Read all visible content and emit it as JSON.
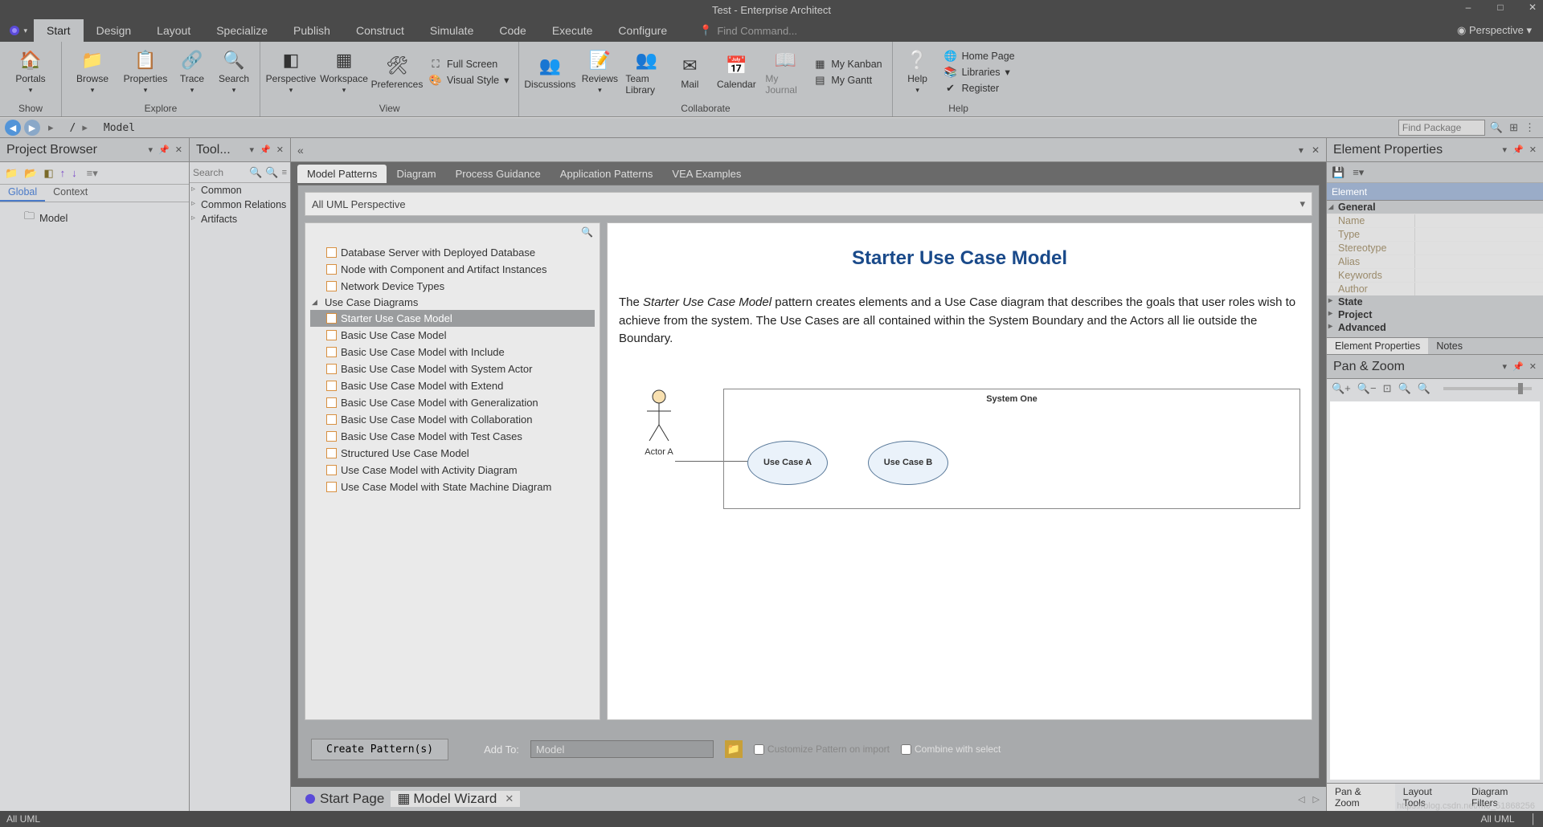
{
  "window": {
    "title": "Test - Enterprise Architect"
  },
  "ribbon": {
    "tabs": [
      "Start",
      "Design",
      "Layout",
      "Specialize",
      "Publish",
      "Construct",
      "Simulate",
      "Code",
      "Execute",
      "Configure"
    ],
    "active": "Start",
    "find_command_ph": "Find Command...",
    "perspective": "Perspective",
    "groups": {
      "show": {
        "label": "Show",
        "portals": "Portals"
      },
      "explore": {
        "label": "Explore",
        "browse": "Browse",
        "properties": "Properties",
        "trace": "Trace",
        "search": "Search"
      },
      "view": {
        "label": "View",
        "perspective": "Perspective",
        "workspace": "Workspace",
        "preferences": "Preferences",
        "fullscreen": "Full Screen",
        "visualstyle": "Visual Style"
      },
      "collaborate": {
        "label": "Collaborate",
        "discussions": "Discussions",
        "reviews": "Reviews",
        "team": "Team Library",
        "mail": "Mail",
        "calendar": "Calendar",
        "journal": "My Journal",
        "kanban": "My Kanban",
        "gantt": "My Gantt"
      },
      "help": {
        "label": "Help",
        "help": "Help",
        "home": "Home Page",
        "libraries": "Libraries",
        "register": "Register"
      }
    }
  },
  "nav": {
    "crumb1": "/",
    "crumb2": "Model",
    "find_package_ph": "Find Package"
  },
  "project_browser": {
    "title": "Project Browser",
    "tabs": [
      "Global",
      "Context"
    ],
    "active": "Global",
    "root": "Model"
  },
  "toolbox": {
    "title": "Tool...",
    "search_ph": "Search",
    "items": [
      "Common",
      "Common Relations",
      "Artifacts"
    ]
  },
  "wizard": {
    "tabs": [
      "Model Patterns",
      "Diagram",
      "Process Guidance",
      "Application Patterns",
      "VEA Examples"
    ],
    "active": "Model Patterns",
    "perspective": "All UML Perspective",
    "deployment_items": [
      "Database Server with Deployed Database",
      "Node with Component and Artifact Instances",
      "Network Device Types"
    ],
    "usecase_cat": "Use Case Diagrams",
    "usecase_items": [
      "Starter Use Case Model",
      "Basic Use Case Model",
      "Basic Use Case Model with Include",
      "Basic Use Case Model with System Actor",
      "Basic Use Case Model with Extend",
      "Basic Use Case Model with Generalization",
      "Basic Use Case Model with Collaboration",
      "Basic Use Case Model with Test Cases",
      "Structured Use Case Model",
      "Use Case Model with Activity Diagram",
      "Use Case Model with State Machine Diagram"
    ],
    "selected": "Starter Use Case Model",
    "preview_title": "Starter Use Case Model",
    "preview_desc_pre": "The ",
    "preview_desc_em": "Starter Use Case Model",
    "preview_desc_post": " pattern creates elements and a Use Case diagram that describes the goals that user roles wish to achieve from the system. The Use Cases are all contained within the System Boundary and the Actors all lie outside the Boundary.",
    "system_label": "System One",
    "actor_label": "Actor A",
    "usecase_a": "Use Case A",
    "usecase_b": "Use Case B",
    "create_btn": "Create Pattern(s)",
    "addto_label": "Add To:",
    "addto_value": "Model",
    "customize": "Customize Pattern on import",
    "combine": "Combine with select"
  },
  "center_tabs": {
    "start": "Start Page",
    "wizard": "Model Wizard"
  },
  "element_props": {
    "title": "Element Properties",
    "category": "Element",
    "sections": {
      "general": "General",
      "state": "State",
      "project": "Project",
      "advanced": "Advanced"
    },
    "rows": [
      "Name",
      "Type",
      "Stereotype",
      "Alias",
      "Keywords",
      "Author"
    ],
    "tabs": [
      "Element Properties",
      "Notes"
    ]
  },
  "panzoom": {
    "title": "Pan & Zoom",
    "tabs": [
      "Pan & Zoom",
      "Layout Tools",
      "Diagram Filters"
    ]
  },
  "status": {
    "left": "All UML",
    "right": "All UML"
  },
  "watermark": "https://blog.csdn.net/m0_51868256"
}
